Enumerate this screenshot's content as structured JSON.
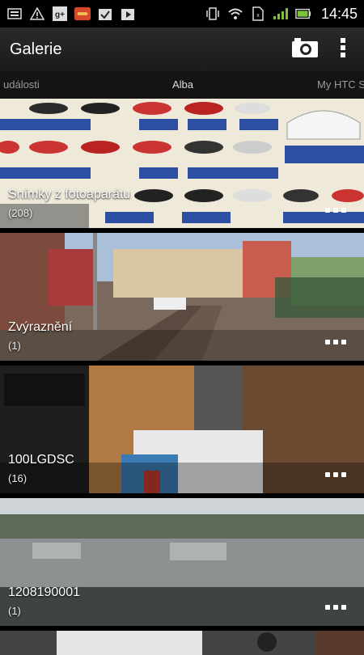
{
  "status_bar": {
    "time": "14:45",
    "left_icons": [
      "notification-icon",
      "warning-icon",
      "google-plus-icon",
      "app-icon",
      "task-icon",
      "play-store-icon"
    ],
    "right_icons": [
      "vibrate-icon",
      "wifi-icon",
      "sim-icon",
      "signal-icon",
      "battery-icon"
    ]
  },
  "app_bar": {
    "title": "Galerie"
  },
  "tabs": [
    {
      "label": "Události",
      "shown": "události"
    },
    {
      "label": "Alba",
      "shown": "Alba"
    },
    {
      "label": "My HTC Sense",
      "shown": "My HTC Sı"
    }
  ],
  "albums": [
    {
      "name": "Snímky z fotoaparátu",
      "count": "(208)"
    },
    {
      "name": "Zvýraznění",
      "count": "(1)"
    },
    {
      "name": "100LGDSC",
      "count": "(16)"
    },
    {
      "name": "1208190001",
      "count": "(1)"
    }
  ],
  "colors": {
    "background": "#000000",
    "app_bar": "#222222",
    "accent": "#ffffff"
  }
}
